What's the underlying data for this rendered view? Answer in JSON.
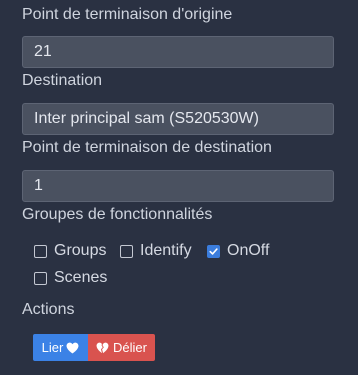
{
  "form": {
    "source_endpoint_label": "Point de terminaison d'origine",
    "source_endpoint_value": "21",
    "destination_label": "Destination",
    "destination_value": "Inter principal sam (S520530W)",
    "dest_endpoint_label": "Point de terminaison de destination",
    "dest_endpoint_value": "1",
    "clusters_label": "Groupes de fonctionnalités",
    "clusters": [
      {
        "label": "Groups",
        "checked": false
      },
      {
        "label": "Identify",
        "checked": false
      },
      {
        "label": "OnOff",
        "checked": true
      },
      {
        "label": "Scenes",
        "checked": false
      }
    ],
    "actions_label": "Actions"
  },
  "buttons": {
    "bind_label": "Lier",
    "bind_icon": "heart-icon",
    "unbind_label": "Délier",
    "unbind_icon": "broken-heart-icon"
  },
  "colors": {
    "background": "#2a3142",
    "field": "#4a5160",
    "accent_blue": "#3b82e6",
    "danger_red": "#d9534f",
    "checkbox_checked": "#3b7ddd"
  }
}
